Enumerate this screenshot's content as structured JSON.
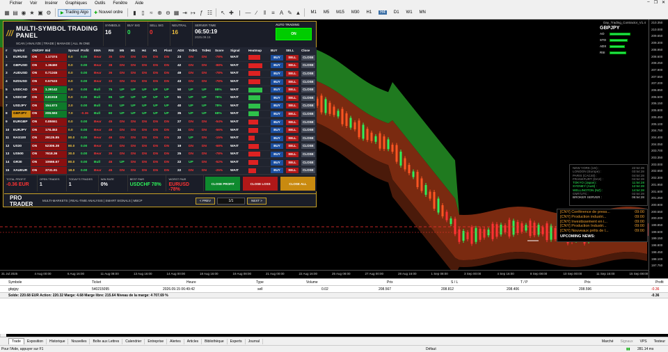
{
  "menu": [
    "Fichier",
    "Voir",
    "Insérer",
    "Graphiques",
    "Outils",
    "Fenêtre",
    "Aide"
  ],
  "toolbar": {
    "algo_label": "Trading Algo",
    "new_order_label": "Nouvel ordre",
    "timeframes": [
      "M1",
      "M5",
      "M15",
      "M30",
      "H1",
      "H4",
      "D1",
      "W1",
      "MN"
    ],
    "selected_tf": "H4"
  },
  "chart": {
    "title": "Day_Trading_Contractor_V1.4",
    "price_labels": [
      "210.350",
      "210.000",
      "209.650",
      "209.300",
      "208.950",
      "208.600",
      "208.250",
      "207.900",
      "207.550",
      "207.200",
      "206.850",
      "206.500",
      "206.150",
      "205.800",
      "205.450",
      "205.100",
      "204.750",
      "204.400",
      "204.050",
      "203.700",
      "203.350",
      "203.000",
      "202.650",
      "202.300",
      "201.950",
      "201.600",
      "201.250",
      "200.900",
      "200.550",
      "200.200",
      "199.850",
      "199.500",
      "199.150",
      "198.800",
      "198.450",
      "198.100",
      "197.750"
    ],
    "time_labels": [
      "31 Jul 2025",
      "4 Aug 00:00",
      "6 Aug 16:00",
      "11 Aug 08:00",
      "13 Aug 16:00",
      "14 Aug 00:00",
      "18 Aug 16:00",
      "19 Aug 08:00",
      "21 Aug 00:00",
      "22 Aug 16:00",
      "25 Aug 08:00",
      "27 Aug 00:00",
      "28 Aug 16:00",
      "1 Sep 08:00",
      "3 Sep 00:00",
      "4 Sep 16:00",
      "8 Sep 08:00",
      "10 Sep 00:00",
      "11 Sep 16:00",
      "15 Sep 08:00"
    ],
    "mini_symbol": "GBPJPY",
    "mini_rows": [
      {
        "label": "AO",
        "pct": 0.75
      },
      {
        "label": "STO",
        "pct": 0.65
      },
      {
        "label": "ADX",
        "pct": 0.55
      },
      {
        "label": "RSI",
        "pct": 0.6
      }
    ]
  },
  "panel": {
    "title": "MULTI-SYMBOL TRADING PANEL",
    "subtitle": "SCAN | ANALYZE | TRADE | MANAGE | ALL IN ONE",
    "symbols_label": "SYMBOLS",
    "symbols_value": "16",
    "buy_label": "BUY SIG",
    "buy_value": "0",
    "sell_label": "SELL SIG",
    "sell_value": "0",
    "neutral_label": "NEUTRAL",
    "neutral_value": "16",
    "server_label": "SERVER TIME",
    "server_time": "06:50:19",
    "server_date": "2025.09.15",
    "auto_label": "AUTO TRADING",
    "auto_btn": "ON",
    "columns": [
      "#",
      "Symbol",
      "ON/OFF",
      "Bid",
      "Spread",
      "Profit",
      "EMA",
      "RSI",
      "M5",
      "M1",
      "H4",
      "H1",
      "Pivot",
      "ADX",
      "TrdH1",
      "TrdH4",
      "Score",
      "Signal",
      "Heatmap",
      "BUY",
      "SELL",
      "Close"
    ],
    "rows": [
      {
        "n": "1",
        "sym": "EURUSD",
        "bid": "1.17374",
        "spr": "0.0",
        "pf": "0.00",
        "ema": "Bear",
        "rsi": "35",
        "m5": "DN",
        "m1": "DN",
        "h4": "DN",
        "h1": "DN",
        "pv": "DN",
        "adx": "23",
        "t1": "DN",
        "t4": "DN",
        "sc": "-78%",
        "sig": "WAIT",
        "heat": 0.55,
        "dir": "dn"
      },
      {
        "n": "2",
        "sym": "GBPUSD",
        "bid": "1.36460",
        "spr": "0.0",
        "pf": "0.00",
        "ema": "Bear",
        "rsi": "38",
        "m5": "DN",
        "m1": "DN",
        "h4": "DN",
        "h1": "DN",
        "pv": "DN",
        "adx": "42",
        "t1": "DN",
        "t4": "DN",
        "sc": "-88%",
        "sig": "WAIT",
        "heat": 0.65,
        "dir": "dn"
      },
      {
        "n": "3",
        "sym": "AUDUSD",
        "bid": "0.71245",
        "spr": "0.0",
        "pf": "0.00",
        "ema": "Bear",
        "rsi": "36",
        "m5": "DN",
        "m1": "DN",
        "h4": "DN",
        "h1": "DN",
        "pv": "DN",
        "adx": "49",
        "t1": "DN",
        "t4": "DN",
        "sc": "-78%",
        "sig": "WAIT",
        "heat": 0.55,
        "dir": "dn"
      },
      {
        "n": "4",
        "sym": "NZDUSD",
        "bid": "0.57533",
        "spr": "0.0",
        "pf": "0.00",
        "ema": "Bear",
        "rsi": "33",
        "m5": "DN",
        "m1": "DN",
        "h4": "DN",
        "h1": "DN",
        "pv": "DN",
        "adx": "43",
        "t1": "DN",
        "t4": "DN",
        "sc": "-78%",
        "sig": "WAIT",
        "heat": 0.55,
        "dir": "dn"
      },
      {
        "n": "5",
        "sym": "USDCAD",
        "bid": "1.39142",
        "spr": "0.0",
        "pf": "0.00",
        "ema": "Bull",
        "rsi": "75",
        "m5": "UP",
        "m1": "UP",
        "h4": "UP",
        "h1": "UP",
        "pv": "UP",
        "adx": "50",
        "t1": "UP",
        "t4": "UP",
        "sc": "88%",
        "sig": "WAIT",
        "heat": 0.65,
        "dir": "up"
      },
      {
        "n": "6",
        "sym": "USDCHF",
        "bid": "0.81918",
        "spr": "0.0",
        "pf": "0.00",
        "ema": "Bull",
        "rsi": "65",
        "m5": "UP",
        "m1": "UP",
        "h4": "UP",
        "h1": "UP",
        "pv": "UP",
        "adx": "51",
        "t1": "UP",
        "t4": "UP",
        "sc": "78%",
        "sig": "WAIT",
        "heat": 0.55,
        "dir": "up"
      },
      {
        "n": "7",
        "sym": "USDJPY",
        "bid": "154.873",
        "spr": "2.0",
        "pf": "0.00",
        "ema": "Bull",
        "rsi": "61",
        "m5": "UP",
        "m1": "UP",
        "h4": "UP",
        "h1": "UP",
        "pv": "UP",
        "adx": "40",
        "t1": "UP",
        "t4": "UP",
        "sc": "78%",
        "sig": "WAIT",
        "heat": 0.55,
        "dir": "up"
      },
      {
        "n": "8",
        "sym": "GBPJPY",
        "bid": "208.593",
        "spr": "7.0",
        "pf": "-0.36",
        "ema": "Bull",
        "rsi": "60",
        "m5": "UP",
        "m1": "UP",
        "h4": "UP",
        "h1": "UP",
        "pv": "UP",
        "adx": "35",
        "t1": "UP",
        "t4": "UP",
        "sc": "68%",
        "sig": "WAIT",
        "heat": 0.5,
        "dir": "up"
      },
      {
        "n": "9",
        "sym": "EURGBP",
        "bid": "0.85551",
        "spr": "0.0",
        "pf": "0.00",
        "ema": "Bear",
        "rsi": "45",
        "m5": "DN",
        "m1": "DN",
        "h4": "DN",
        "h1": "DN",
        "pv": "DN",
        "adx": "27",
        "t1": "DN",
        "t4": "DN",
        "sc": "-54%",
        "sig": "WAIT",
        "heat": 0.45,
        "dir": "dn"
      },
      {
        "n": "10",
        "sym": "EURJPY",
        "bid": "178.453",
        "spr": "0.0",
        "pf": "0.00",
        "ema": "Bear",
        "rsi": "49",
        "m5": "DN",
        "m1": "DN",
        "h4": "DN",
        "h1": "DN",
        "pv": "DN",
        "adx": "34",
        "t1": "DN",
        "t4": "DN",
        "sc": "-56%",
        "sig": "WAIT",
        "heat": 0.45,
        "dir": "dn"
      },
      {
        "n": "11",
        "sym": "NAS100",
        "bid": "29125.85",
        "spr": "80.0",
        "pf": "0.00",
        "ema": "Bear",
        "rsi": "46",
        "m5": "DN",
        "m1": "DN",
        "h4": "DN",
        "h1": "DN",
        "pv": "DN",
        "adx": "22",
        "t1": "UP",
        "t4": "DN",
        "sc": "-15%",
        "sig": "WAIT",
        "heat": 0.3,
        "dir": "dn"
      },
      {
        "n": "12",
        "sym": "US30",
        "bid": "52306.38",
        "spr": "80.0",
        "pf": "0.00",
        "ema": "Bear",
        "rsi": "40",
        "m5": "DN",
        "m1": "DN",
        "h4": "DN",
        "h1": "DN",
        "pv": "DN",
        "adx": "19",
        "t1": "DN",
        "t4": "DN",
        "sc": "-68%",
        "sig": "WAIT",
        "heat": 0.5,
        "dir": "dn"
      },
      {
        "n": "13",
        "sym": "US500",
        "bid": "7618.36",
        "spr": "30.0",
        "pf": "0.00",
        "ema": "Bear",
        "rsi": "39",
        "m5": "DN",
        "m1": "DN",
        "h4": "DN",
        "h1": "DN",
        "pv": "DN",
        "adx": "25",
        "t1": "DN",
        "t4": "DN",
        "sc": "-78%",
        "sig": "WAIT",
        "heat": 0.55,
        "dir": "dn"
      },
      {
        "n": "14",
        "sym": "GR30",
        "bid": "10666.67",
        "spr": "80.0",
        "pf": "0.00",
        "ema": "Bull",
        "rsi": "46",
        "m5": "UP",
        "m1": "DN",
        "h4": "DN",
        "h1": "DN",
        "pv": "DN",
        "adx": "22",
        "t1": "UP",
        "t4": "DN",
        "sc": "-52%",
        "sig": "WAIT",
        "heat": 0.45,
        "dir": "dn"
      },
      {
        "n": "15",
        "sym": "XAUEUR",
        "bid": "3731.91",
        "spr": "18.0",
        "pf": "0.00",
        "ema": "Bear",
        "rsi": "45",
        "m5": "DN",
        "m1": "DN",
        "h4": "DN",
        "h1": "DN",
        "pv": "DN",
        "adx": "22",
        "t1": "DN",
        "t4": "DN",
        "sc": "-25%",
        "sig": "WAIT",
        "heat": 0.35,
        "dir": "dn"
      },
      {
        "n": "16",
        "sym": "XAUUSD",
        "bid": "4306.67",
        "spr": "0.0",
        "pf": "0.00",
        "ema": "Bear",
        "rsi": "40",
        "m5": "UP",
        "m1": "DN",
        "h4": "DN",
        "h1": "DN",
        "pv": "UP",
        "adx": "36",
        "t1": "UP",
        "t4": "UP",
        "sc": "-25%",
        "sig": "WAIT",
        "heat": 0.35,
        "dir": "dn"
      }
    ],
    "buy_label_btn": "BUY",
    "sell_label_btn": "SELL",
    "close_label_btn": "CLOSE",
    "total_profit_label": "TOTAL PROFIT",
    "total_profit": "-0.36 EUR",
    "open_trades_label": "OPEN TRADES",
    "open_trades": "1",
    "today_trades_label": "TODAY'S TRADES",
    "today_trades": "1",
    "win_rate_label": "WIN RATE",
    "win_rate": "0%",
    "best_pair_label": "BEST PAIR",
    "best_pair": "USDCHF 78%",
    "worst_pair_label": "WORST PAIR",
    "worst_pair": "EURUSD -78%",
    "close_profit_btn": "CLOSE PROFIT",
    "close_loss_btn": "CLOSE LOSS",
    "close_all_btn": "CLOSE ALL",
    "brand": "PRO TRADER",
    "tagline": "MULTI-MARKETS | REAL-TIME ANALYSIS | SMART SIGNALS | MBCP",
    "prev_btn": "< PREV",
    "next_btn": "NEXT >",
    "page": "1/1"
  },
  "sessions": [
    {
      "name": "NEW YORK (US) :",
      "time": "22:54:28",
      "state": "closed"
    },
    {
      "name": "LONDON (Europe) :",
      "time": "03:54:28",
      "state": "closed"
    },
    {
      "name": "PARIS (CAC40) :",
      "time": "04:54:28",
      "state": "closed"
    },
    {
      "name": "FRANKFURT (DAX) :",
      "time": "04:54:28",
      "state": "closed"
    },
    {
      "name": "TOKYO (Japan) :",
      "time": "11:54:28",
      "state": "open"
    },
    {
      "name": "SYDNEY (Aust) :",
      "time": "12:54:28",
      "state": "open"
    },
    {
      "name": "WELLINGTON (NZ) :",
      "time": "14:54:28",
      "state": "open"
    },
    {
      "name": "GMT/UTC :",
      "time": "02:54:28",
      "state": "closed"
    },
    {
      "name": "BROKER SERVER :",
      "time": "06:54:28",
      "state": "closed"
    }
  ],
  "calendar": {
    "items": [
      {
        "t": "[CNY] Conférence de press...",
        "v": "09:00"
      },
      {
        "t": "[CNY] Production industri...",
        "v": "09:00"
      },
      {
        "t": "[CNY] Investissement en i...",
        "v": "09:00"
      },
      {
        "t": "[CNY] Production Industri...",
        "v": "09:00"
      },
      {
        "t": "[CNY] Nouveaux prêts de l...",
        "v": "09:00"
      }
    ],
    "upcoming": "UPCOMING NEWS:"
  },
  "orders": {
    "headers": {
      "symbole": "Symbole",
      "ticket": "Ticket",
      "heure": "Heure",
      "type": "Type",
      "volume": "Volume",
      "prix": "Prix",
      "sl": "S / L",
      "tp": "T / P",
      "prix2": "Prix",
      "profit": "Profit"
    },
    "row": {
      "symbole": "gbpjpy",
      "ticket": "540215095",
      "heure": "2026.09.15 06:49:42",
      "type": "sell",
      "volume": "0.02",
      "prix": "208.567",
      "sl": "208.812",
      "tp": "208.406",
      "prix2": "208.596",
      "profit": "-0.36"
    },
    "balance": "Solde: 220.68 EUR  Action: 220.32  Marge: 4.68  Marge libre: 215.64  Niveau de la marge: 4 707.69 %",
    "balance_profit": "-0.36"
  },
  "side_label": "Boîte à outils",
  "tabs": [
    "Trade",
    "Exposition",
    "Historique",
    "Nouvelles",
    "Boîte aux Lettres",
    "Calendrier",
    "Entreprise",
    "Alertes",
    "Articles",
    "Bibliothèque",
    "Experts",
    "Journal"
  ],
  "tabs_right": [
    "Marché",
    "Signaux",
    "VPS",
    "Testeur"
  ],
  "status": {
    "help": "Pour l'Aide, appuyer sur F1",
    "profile": "Défaut",
    "net": "281.14 ms"
  }
}
